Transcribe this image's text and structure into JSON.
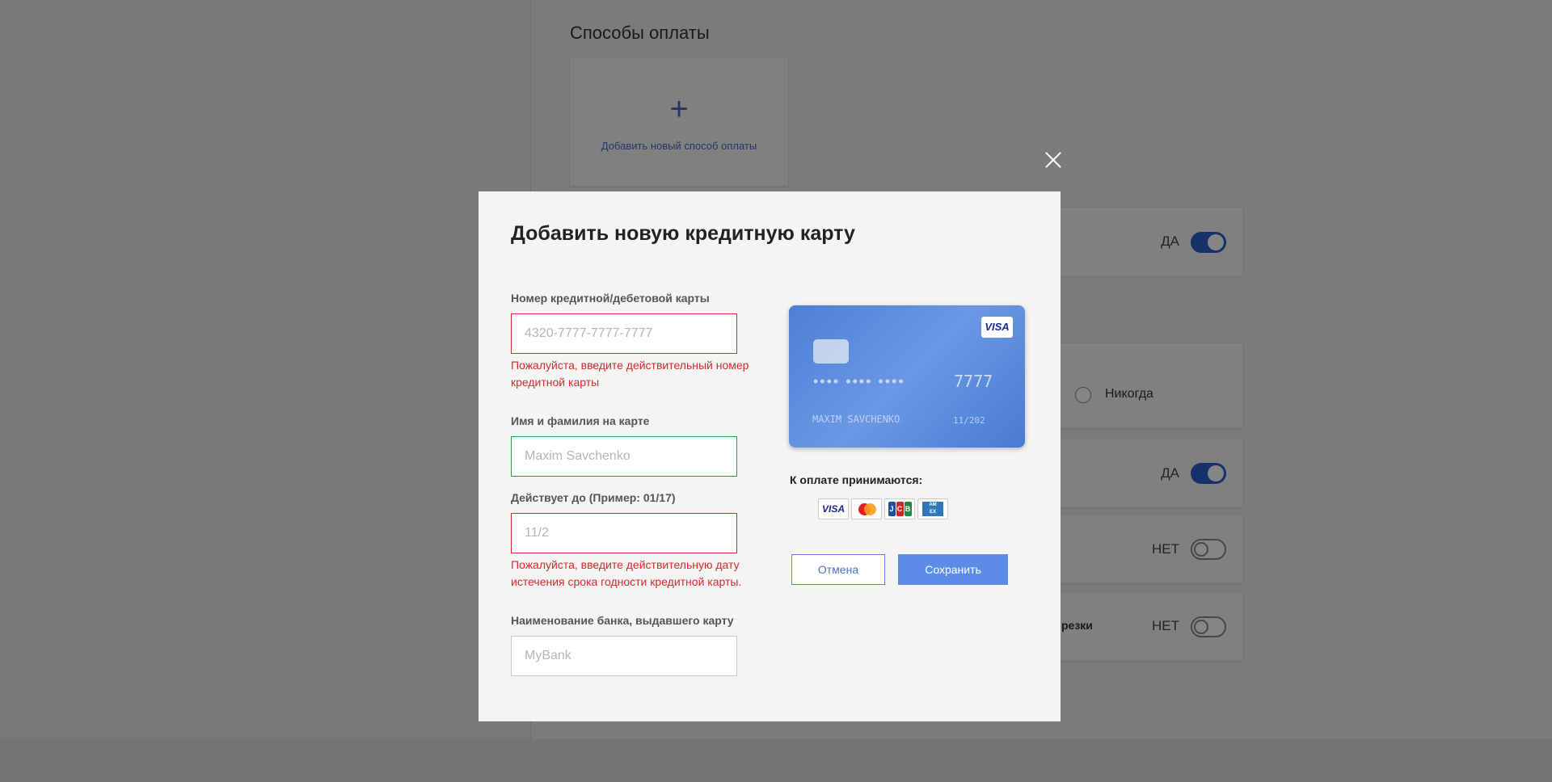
{
  "background": {
    "section_title": "Способы оплаты",
    "add_method": {
      "plus": "+",
      "label": "Добавить новый способ оплаты"
    },
    "rows": [
      {
        "value": "ДА",
        "state": "on"
      },
      {
        "radio_label": "Никогда"
      },
      {
        "value": "ДА",
        "state": "on"
      },
      {
        "value": "НЕТ",
        "state": "off"
      },
      {
        "label_fragment": "резки",
        "value": "НЕТ",
        "state": "off"
      }
    ]
  },
  "modal": {
    "title": "Добавить новую кредитную карту",
    "card_number": {
      "label": "Номер кредитной/дебетовой карты",
      "placeholder": "4320-7777-7777-7777",
      "error": "Пожалуйста, введите действительный номер кредитной карты"
    },
    "card_holder": {
      "label": "Имя и фамилия на карте",
      "placeholder": "Maxim Savchenko"
    },
    "expiry": {
      "label": "Действует до (Пример: 01/17)",
      "placeholder": "11/2",
      "error": "Пожалуйста, введите действительную дату истечения срока годности кредитной карты."
    },
    "bank": {
      "label": "Наименование банка, выдавшего карту",
      "placeholder": "MyBank"
    },
    "card_preview": {
      "brand": "VISA",
      "masked_groups": "•••• •••• ••••",
      "last_digits": "7777",
      "holder": "MAXIM SAVCHENKO",
      "expiry": "11/202"
    },
    "accepted_label": "К оплате принимаются:",
    "accepted_icons": [
      "visa-icon",
      "mastercard-icon",
      "jcb-icon",
      "amex-icon"
    ],
    "cancel_label": "Отмена",
    "save_label": "Сохранить"
  },
  "colors": {
    "accent": "#5b8ce8",
    "error": "#d42a2a",
    "valid": "#2e9b49",
    "toggle_on": "#2a5fc6"
  }
}
